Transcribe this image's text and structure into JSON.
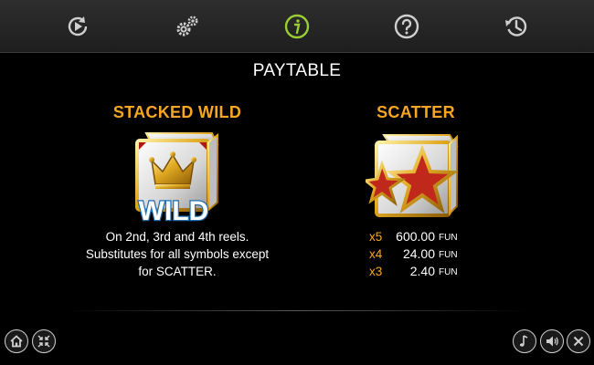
{
  "tabs": [
    {
      "icon": "replay-icon"
    },
    {
      "icon": "settings-gears-icon"
    },
    {
      "icon": "info-icon",
      "active": true
    },
    {
      "icon": "help-icon"
    },
    {
      "icon": "history-icon"
    }
  ],
  "colors": {
    "accent": "#f6a623",
    "active_tab": "#9acd32",
    "icon": "#cfcfcf",
    "background": "#000000"
  },
  "page": {
    "title": "PAYTABLE"
  },
  "wild": {
    "title": "STACKED WILD",
    "symbol_text": "WILD",
    "description": [
      "On 2nd, 3rd and 4th reels.",
      "Substitutes for all symbols except",
      "for SCATTER."
    ]
  },
  "scatter": {
    "title": "SCATTER",
    "payouts": [
      {
        "mult": "x5",
        "value": "600.00",
        "currency": "FUN"
      },
      {
        "mult": "x4",
        "value": "24.00",
        "currency": "FUN"
      },
      {
        "mult": "x3",
        "value": "2.40",
        "currency": "FUN"
      }
    ]
  },
  "bottom_left": [
    {
      "icon": "home-icon"
    },
    {
      "icon": "fullscreen-exit-icon"
    }
  ],
  "bottom_right": [
    {
      "icon": "music-icon"
    },
    {
      "icon": "sound-icon"
    },
    {
      "icon": "close-icon"
    }
  ]
}
